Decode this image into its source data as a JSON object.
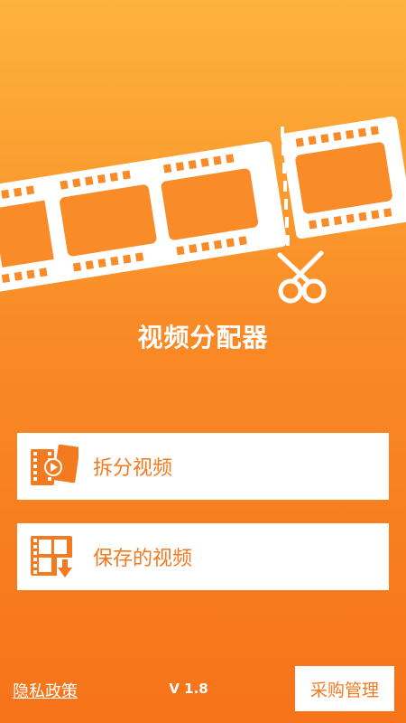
{
  "app": {
    "title": "视频分配器"
  },
  "menu": {
    "split_label": "拆分视频",
    "saved_label": "保存的视频"
  },
  "footer": {
    "privacy_label": "隐私政策",
    "version": "V 1.8",
    "purchase_label": "采购管理"
  },
  "icons": {
    "hero": "film-strip-scissors-icon",
    "split": "video-split-icon",
    "saved": "saved-video-icon"
  },
  "colors": {
    "gradient_top": "#FDB33C",
    "gradient_bottom": "#F7731A",
    "accent": "#F47A1F",
    "surface": "#FFFFFF"
  }
}
